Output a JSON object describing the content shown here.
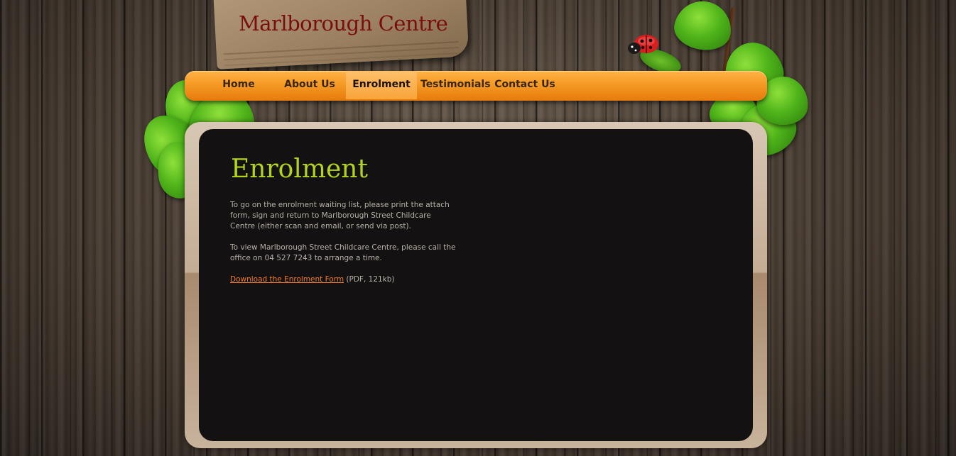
{
  "header": {
    "site_title": "Marlborough Centre"
  },
  "nav": {
    "items": [
      {
        "label": "Home"
      },
      {
        "label": "About Us"
      },
      {
        "label": "Enrolment"
      },
      {
        "label": "Testimonials"
      },
      {
        "label": "Contact Us"
      }
    ],
    "active": "Enrolment"
  },
  "main": {
    "heading": "Enrolment",
    "paragraph1": "To go on the enrolment waiting list, please print the attach form, sign and return to Marlborough Street Childcare Centre (either scan and email, or send via post).",
    "paragraph2": "To view Marlborough Street Childcare Centre, please call the office on 04 527 7243 to arrange a time.",
    "download_link": "Download the Enrolment Form",
    "download_info": " (PDF, 121kb)"
  },
  "colors": {
    "nav_orange": "#f59a25",
    "heading_green": "#b3d41c",
    "title_red": "#7a0d0d",
    "link_orange": "#f07a2a"
  }
}
